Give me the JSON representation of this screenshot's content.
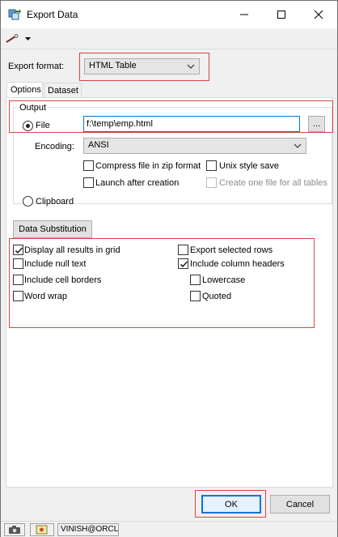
{
  "window": {
    "title": "Export Data",
    "icons": {
      "app": "export-data-icon",
      "minimize": "minimize-icon",
      "maximize": "maximize-icon",
      "close": "close-icon"
    }
  },
  "toolbar": {
    "tool_icon": "wand-icon",
    "dropdown_icon": "chevron-down-icon"
  },
  "export_format": {
    "label": "Export format:",
    "value": "HTML Table"
  },
  "tabs": [
    {
      "label": "Options",
      "active": true
    },
    {
      "label": "Dataset",
      "active": false
    }
  ],
  "output": {
    "group_label": "Output",
    "file_label": "File",
    "file_path": "f:\\temp\\emp.html",
    "browse_label": "...",
    "encoding_label": "Encoding:",
    "encoding_value": "ANSI",
    "compress_label": "Compress file in zip format",
    "unix_label": "Unix style save",
    "launch_label": "Launch after creation",
    "one_file_label": "Create one file for all tables",
    "clipboard_label": "Clipboard"
  },
  "data_substitution_label": "Data Substitution",
  "options": {
    "display_all": "Display all results in grid",
    "include_null": "Include null text",
    "include_borders": "Include cell borders",
    "word_wrap": "Word wrap",
    "export_selected": "Export selected rows",
    "include_headers": "Include column headers",
    "lowercase": "Lowercase",
    "quoted": "Quoted"
  },
  "buttons": {
    "ok": "OK",
    "cancel": "Cancel"
  },
  "status": {
    "connection": "VINISH@ORCL"
  },
  "colors": {
    "highlight_red": "#d64545",
    "accent_blue": "#0078d7"
  }
}
